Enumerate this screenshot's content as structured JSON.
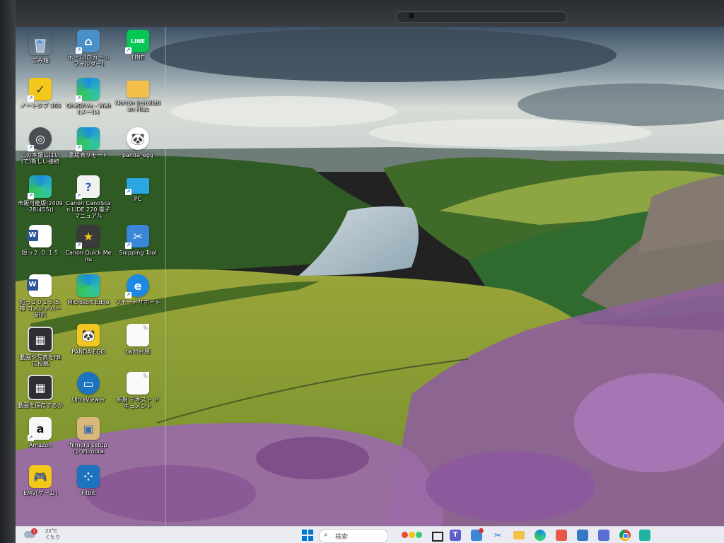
{
  "desktop": {
    "icons": [
      {
        "label": "ごみ箱",
        "icon": "recycle-bin-icon"
      },
      {
        "label": "ノートタブ 365",
        "icon": "todo-check-icon"
      },
      {
        "label": "この本類にはい(で)新しい接続",
        "icon": "camera-app-icon"
      },
      {
        "label": "市販可能版(2409-28(455))",
        "icon": "edge-beta-icon"
      },
      {
        "label": "短っ２.０.１５",
        "icon": "word-doc-icon"
      },
      {
        "label": "短っ２０１５.5.神 コメンドバー研究",
        "icon": "word-doc-icon"
      },
      {
        "label": "動画や写真をFBに投稿",
        "icon": "video-app-icon"
      },
      {
        "label": "動画を保存するか",
        "icon": "video-app-icon"
      },
      {
        "label": "Amazon",
        "icon": "amazon-icon"
      },
      {
        "label": "EMV[ゲーム]",
        "icon": "game-controller-icon"
      },
      {
        "label": "ホーム(ロカールフォルダー)",
        "icon": "home-network-icon"
      },
      {
        "label": "OneDrive - Web(メール)",
        "icon": "edge-icon"
      },
      {
        "label": "番組表リモート",
        "icon": "edge-icon"
      },
      {
        "label": "Canon CanoScan LiDE 220 電子マニュアル",
        "icon": "help-document-icon"
      },
      {
        "label": "Canon Quick Menu",
        "icon": "canon-quick-menu-icon"
      },
      {
        "label": "Microsoft Edge",
        "icon": "edge-icon"
      },
      {
        "label": "PANDA EGG",
        "icon": "panda-icon"
      },
      {
        "label": "UltraViewer",
        "icon": "ultraviewer-icon"
      },
      {
        "label": "filmora setup(ジ)Filmora",
        "icon": "installer-box-icon"
      },
      {
        "label": "Fitbit",
        "icon": "fitbit-icon"
      },
      {
        "label": "LINE",
        "icon": "line-icon"
      },
      {
        "label": "Norton Installation Files",
        "icon": "folder-icon"
      },
      {
        "label": "panda_egg",
        "icon": "panda-icon"
      },
      {
        "label": "PC",
        "icon": "pc-monitor-icon"
      },
      {
        "label": "Snipping Tool",
        "icon": "snipping-tool-icon"
      },
      {
        "label": "リモートサポート",
        "icon": "ie-icon"
      },
      {
        "label": "twitter用",
        "icon": "text-file-icon"
      },
      {
        "label": "新規 テキスト ドキュメント",
        "icon": "text-file-icon"
      }
    ]
  },
  "taskbar": {
    "weather": {
      "temp": "22°C",
      "cond": "くもり",
      "badge": "1"
    },
    "search_placeholder": "検索",
    "apps": [
      "start-icon",
      "search-icon",
      "copilot-icon",
      "task-view-icon",
      "teams-icon",
      "widgets-icon",
      "snip-icon",
      "file-explorer-icon",
      "edge-icon",
      "app-red-icon",
      "store-icon",
      "settings-icon",
      "chrome-icon",
      "app-teal-icon"
    ]
  },
  "colors": {
    "taskbar_bg": "#eef0f6",
    "accent": "#0067c0"
  }
}
